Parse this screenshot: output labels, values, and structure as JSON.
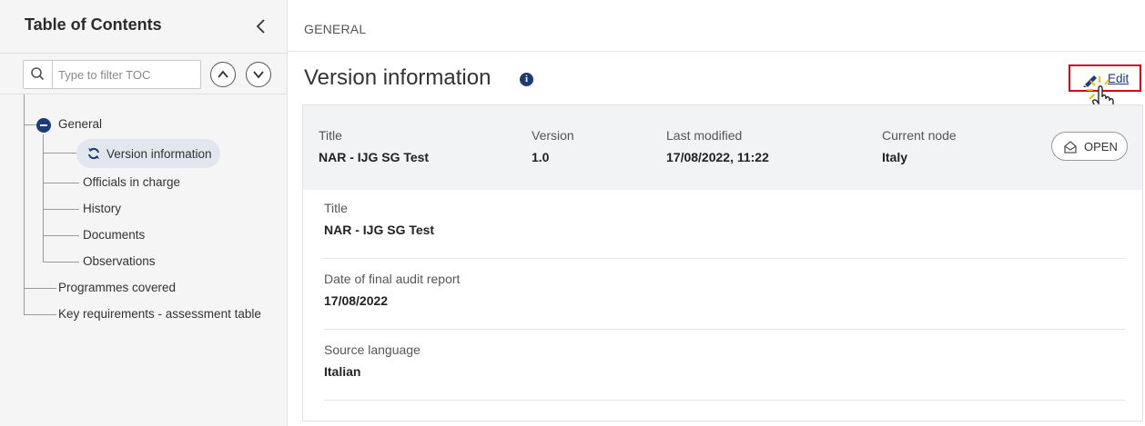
{
  "sidebar": {
    "title": "Table of Contents",
    "filter_placeholder": "Type to filter TOC",
    "items": {
      "general": "General",
      "version_information": "Version information",
      "officials_in_charge": "Officials in charge",
      "history": "History",
      "documents": "Documents",
      "observations": "Observations",
      "programmes_covered": "Programmes covered",
      "key_requirements": "Key requirements - assessment table"
    }
  },
  "main": {
    "breadcrumb": "GENERAL",
    "title": "Version information",
    "edit_label": "Edit",
    "header": {
      "title_label": "Title",
      "title_value": "NAR - IJG SG Test",
      "version_label": "Version",
      "version_value": "1.0",
      "modified_label": "Last modified",
      "modified_value": "17/08/2022, 11:22",
      "node_label": "Current node",
      "node_value": "Italy",
      "status": "OPEN"
    },
    "fields": [
      {
        "label": "Title",
        "value": "NAR - IJG SG Test"
      },
      {
        "label": "Date of final audit report",
        "value": "17/08/2022"
      },
      {
        "label": "Source language",
        "value": "Italian"
      }
    ]
  },
  "colors": {
    "accent": "#1d3b78",
    "highlight_border": "#d0021b",
    "sidebar_bg": "#f5f5f6",
    "header_bg": "#f2f3f5"
  },
  "icons": [
    "search-icon",
    "chevron-left-icon",
    "chevron-up-icon",
    "chevron-down-icon",
    "minus-circle-icon",
    "refresh-icon",
    "info-icon",
    "pencil-icon",
    "envelope-open-icon",
    "hand-cursor-icon"
  ]
}
